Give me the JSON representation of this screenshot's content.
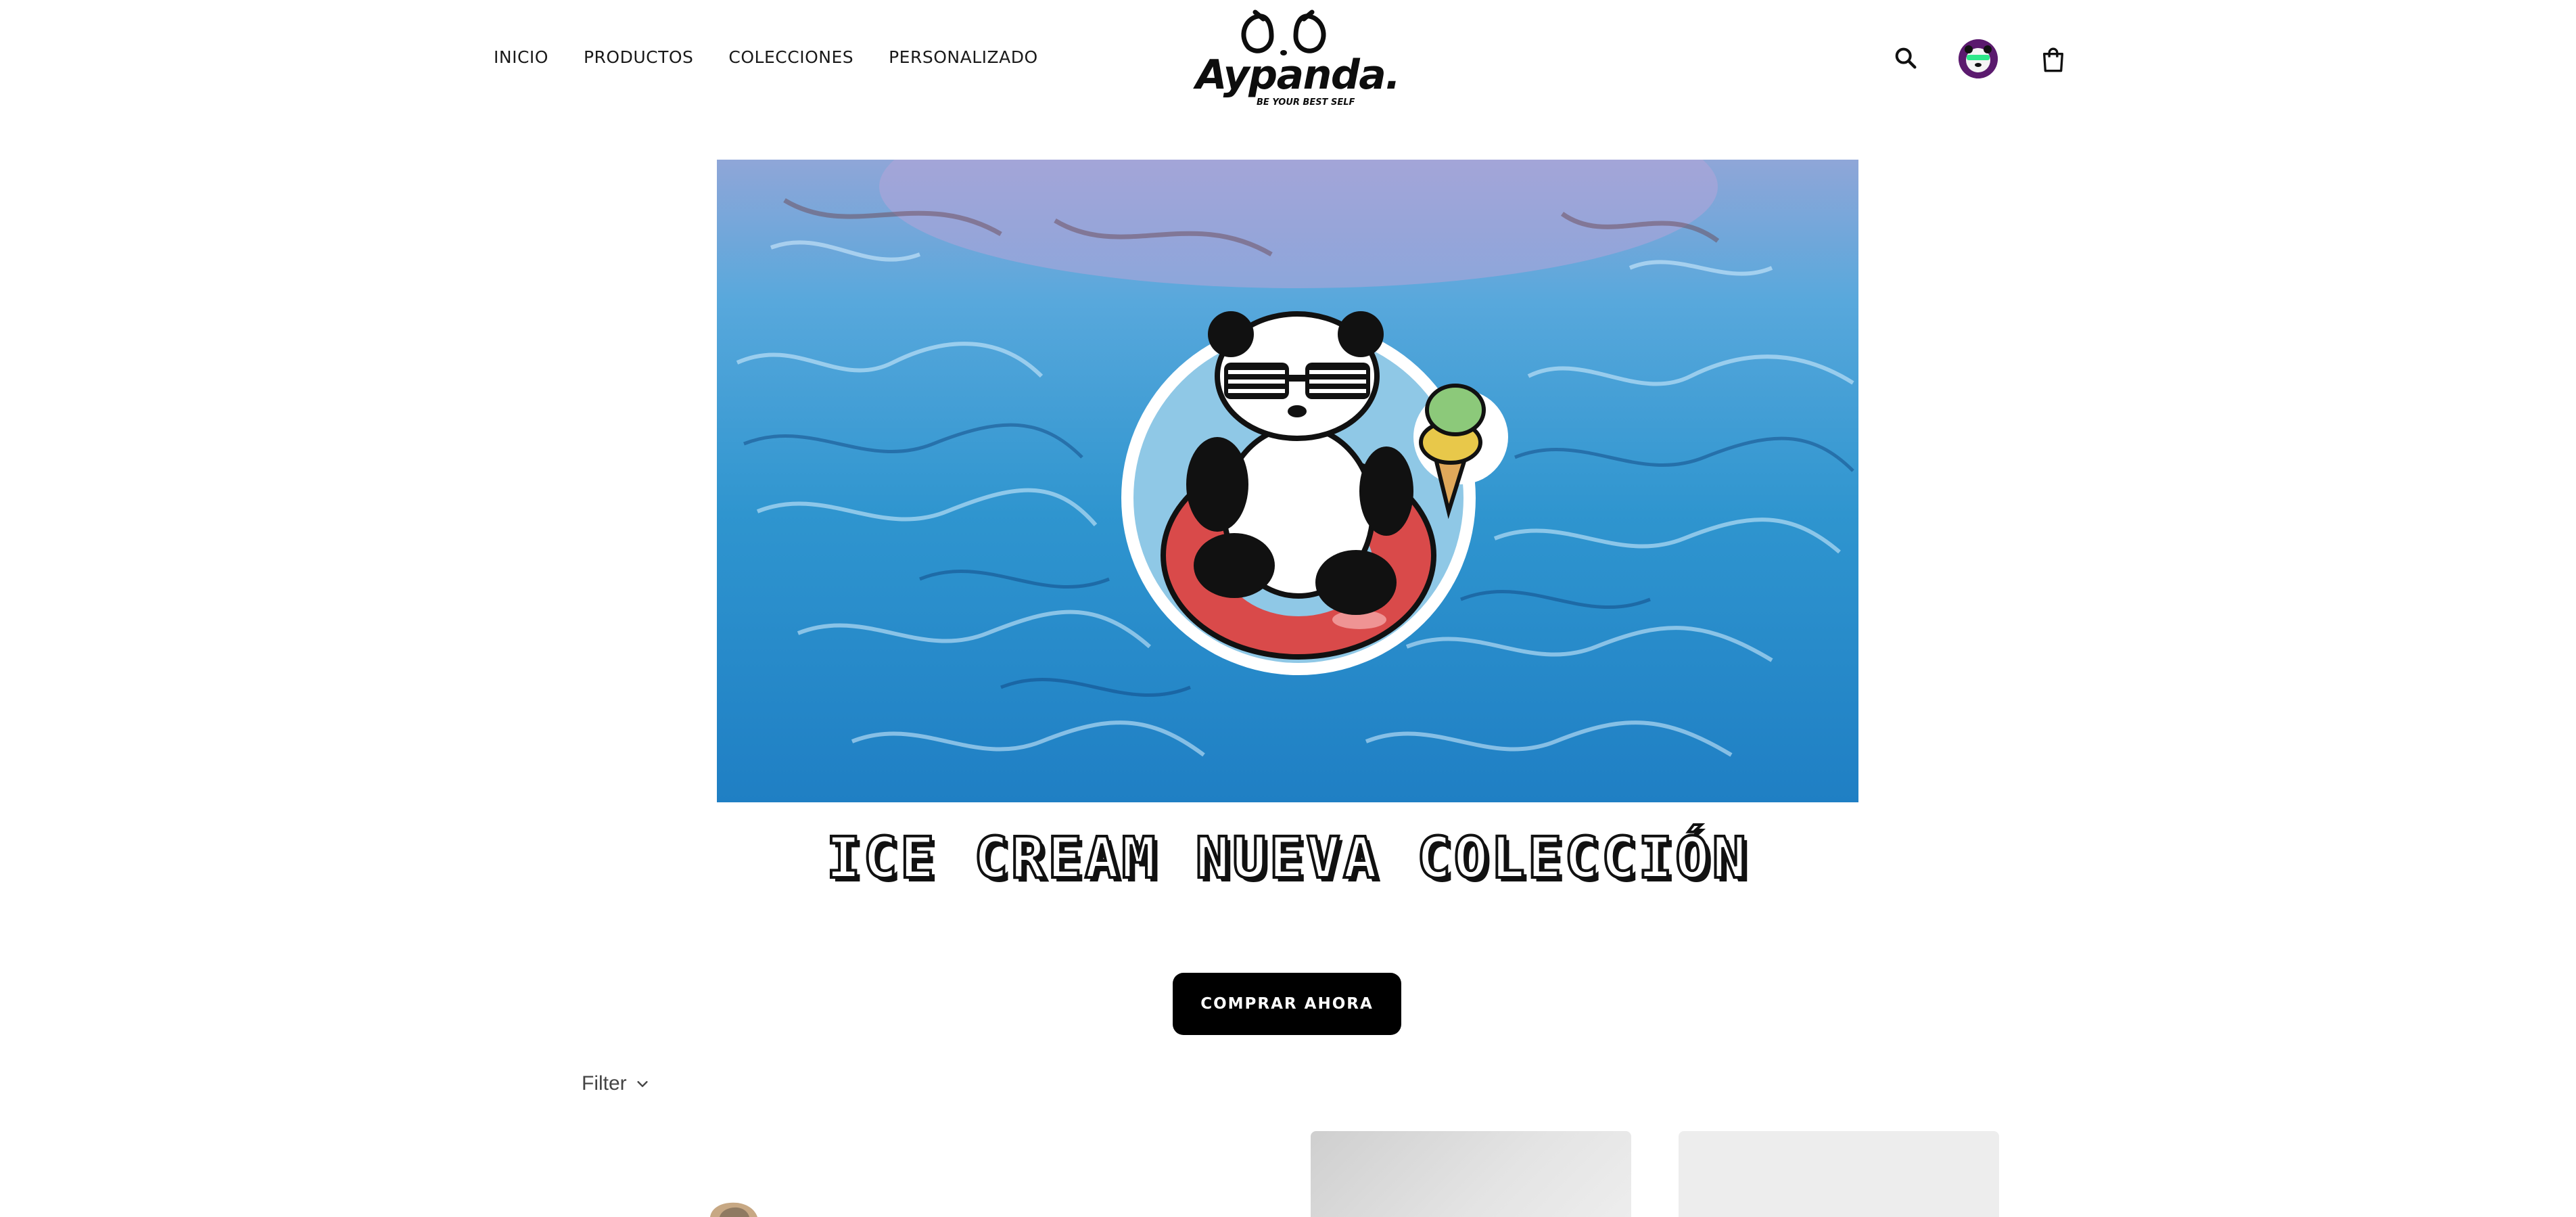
{
  "header": {
    "nav_items": [
      {
        "label": "INICIO"
      },
      {
        "label": "PRODUCTOS"
      },
      {
        "label": "COLECCIONES"
      },
      {
        "label": "PERSONALIZADO"
      }
    ],
    "logo": {
      "name": "Aypanda.",
      "tagline": "BE YOUR BEST SELF"
    },
    "icons": [
      "search-icon",
      "avatar",
      "cart-icon"
    ]
  },
  "hero": {
    "title": "ICE CREAM NUEVA COLECCIÓN",
    "cta_label": "COMPRAR AHORA",
    "colors": {
      "water": "#2f95cf",
      "cta_bg": "#000000"
    }
  },
  "collection": {
    "filter_label": "Filter",
    "filter_icon": "chevron-down-icon"
  }
}
